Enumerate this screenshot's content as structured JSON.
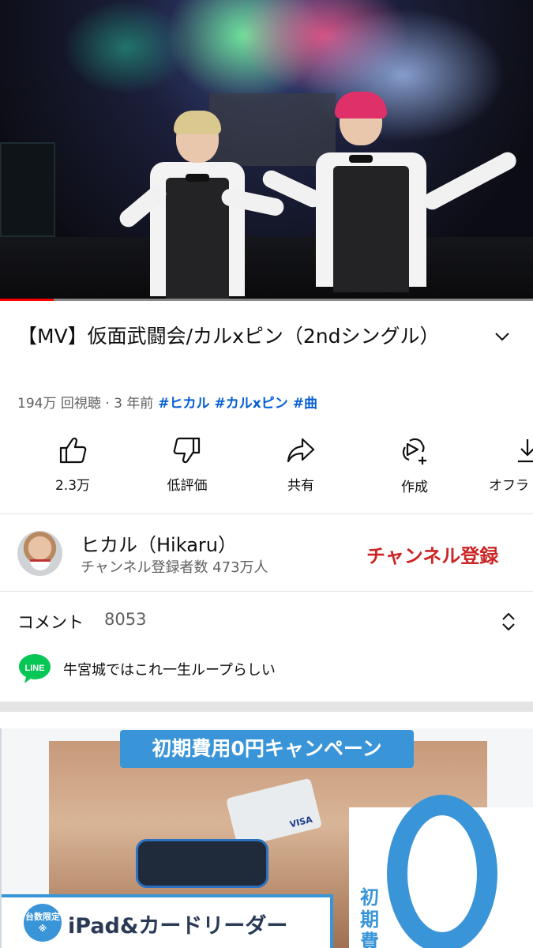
{
  "video": {
    "progress_percent": 10
  },
  "title": "【MV】仮面武闘会/カルxピン（2ndシングル）",
  "meta": {
    "views": "194万 回視聴 · 3 年前",
    "hashtags": [
      "#ヒカル",
      "#カルxピン",
      "#曲"
    ]
  },
  "actions": [
    {
      "label": "2.3万",
      "icon": "thumbs-up-icon"
    },
    {
      "label": "低評価",
      "icon": "thumbs-down-icon"
    },
    {
      "label": "共有",
      "icon": "share-icon"
    },
    {
      "label": "作成",
      "icon": "create-remix-icon"
    },
    {
      "label": "オフラ",
      "icon": "download-icon"
    }
  ],
  "channel": {
    "name": "ヒカル（Hikaru）",
    "subscribers": "チャンネル登録者数 473万人",
    "subscribe_label": "チャンネル登録"
  },
  "comments": {
    "label": "コメント",
    "count": "8053",
    "top_comment": "牛宮城ではこれ一生ループらしい",
    "top_comment_avatar": "LINE"
  },
  "ad": {
    "banner": "初期費用0円キャンペーン",
    "badge": "台数限定※",
    "product": "iPad&カードリーダー",
    "vertical": "初期費用",
    "card_brand": "VISA"
  },
  "colors": {
    "accent_red": "#ff0000",
    "subscribe_red": "#cc2525",
    "link_blue": "#065fd4",
    "ad_blue": "#3a95d8",
    "line_green": "#06c755"
  }
}
